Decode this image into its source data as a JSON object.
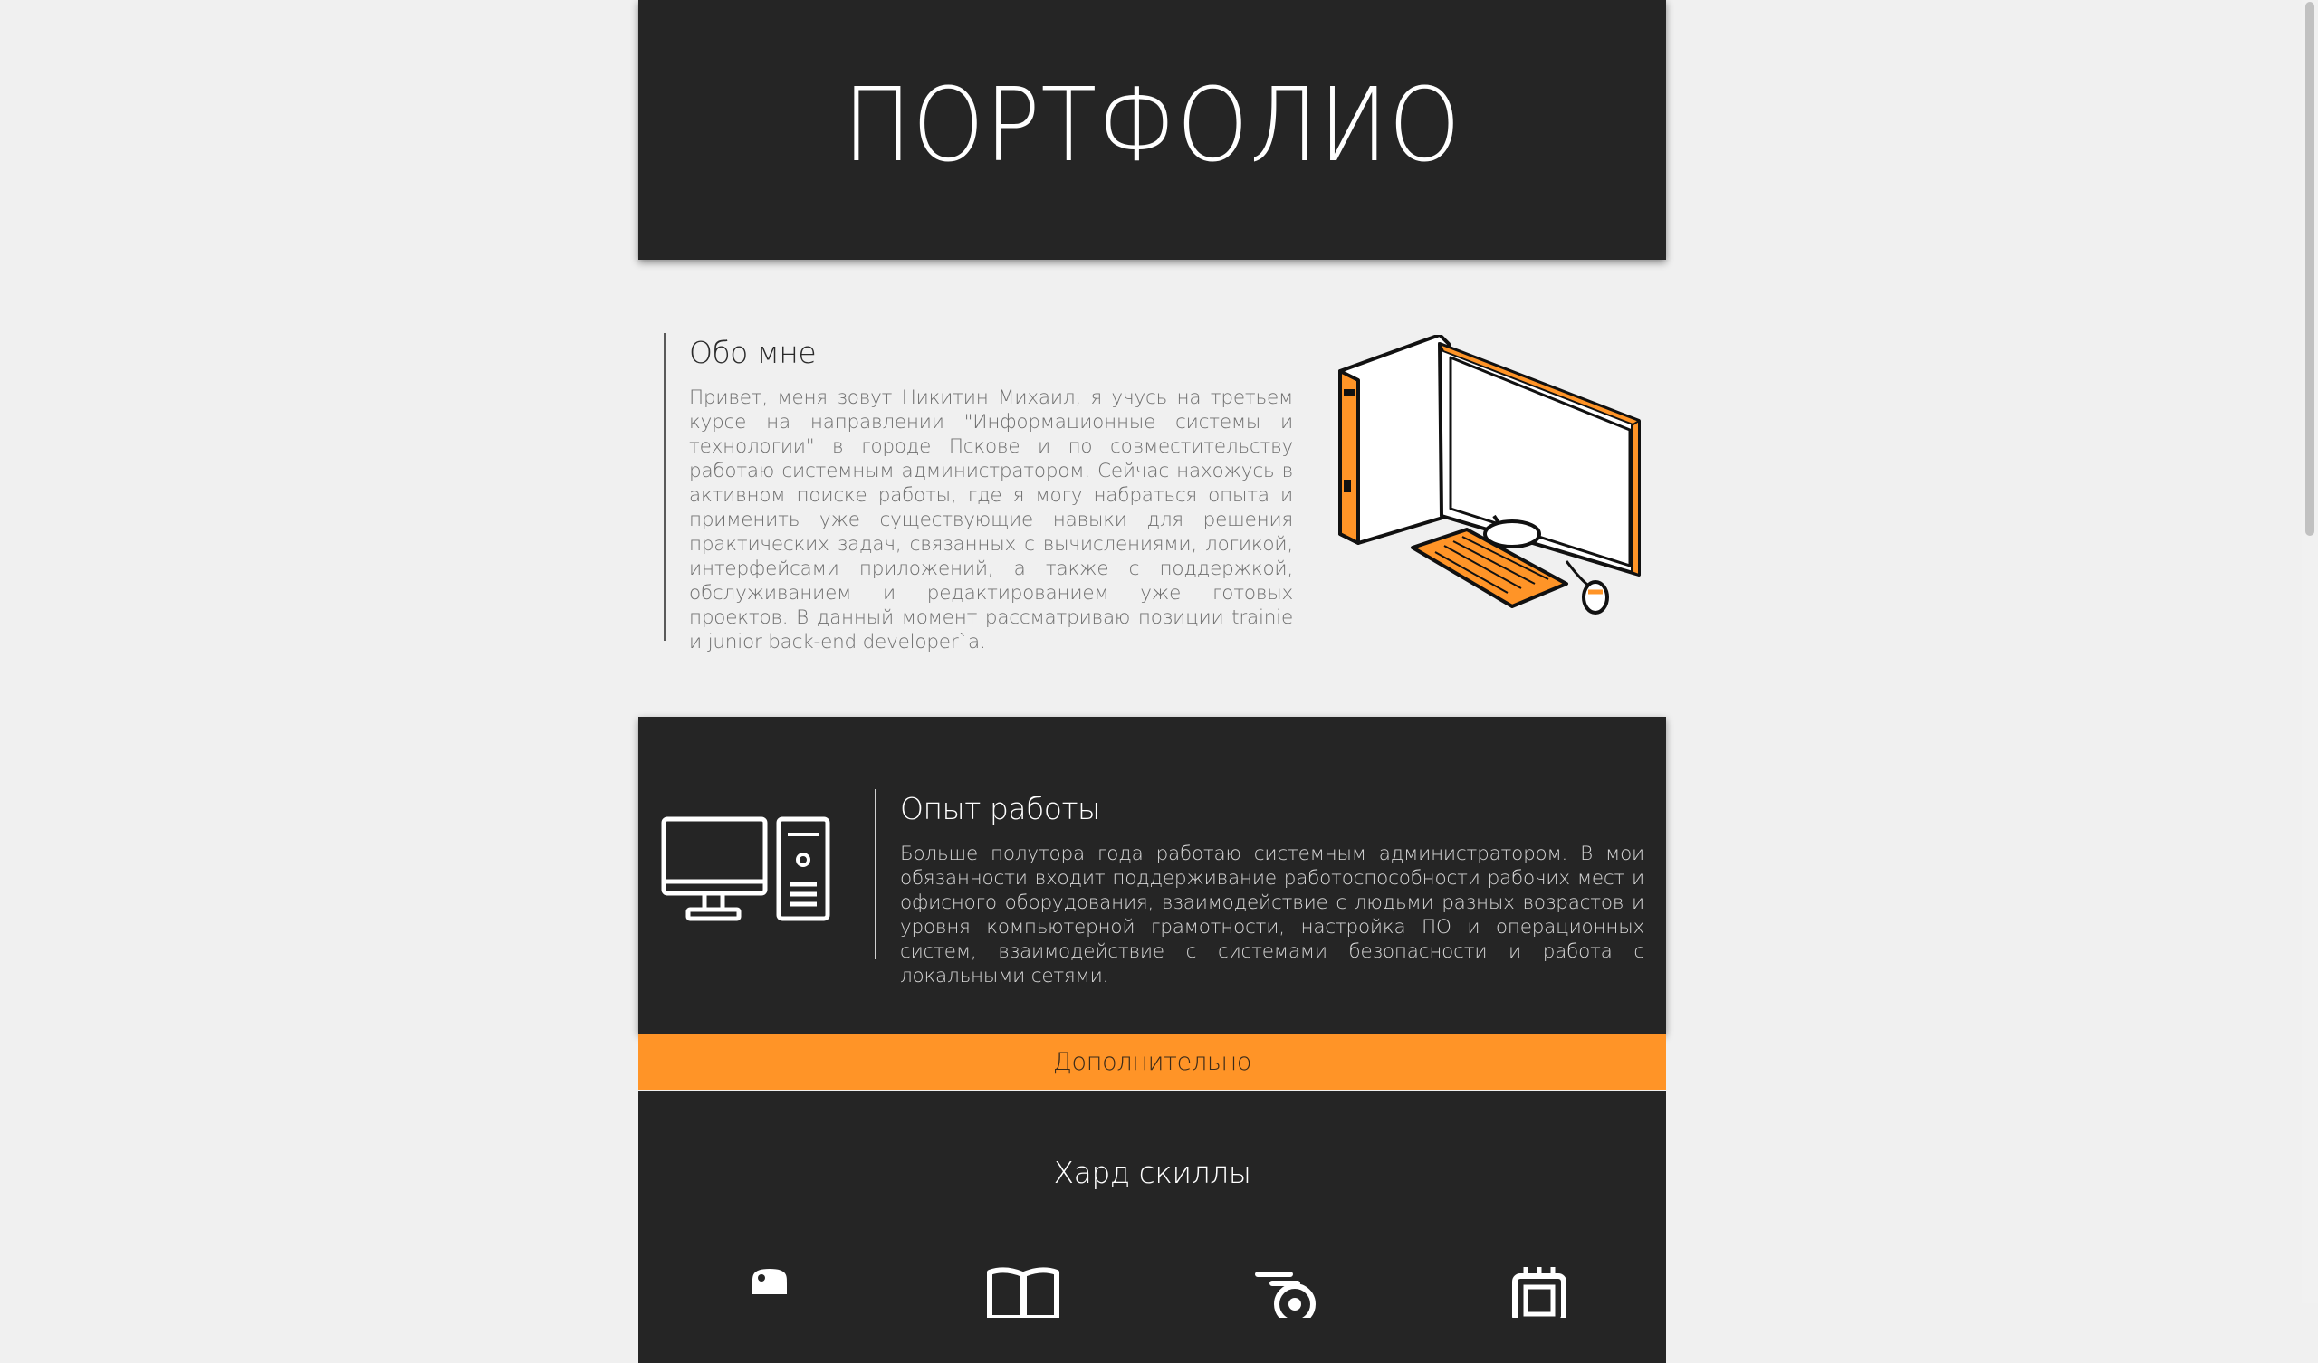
{
  "hero": {
    "title": "ПОРТФОЛИО"
  },
  "about": {
    "heading": "Обо мне",
    "text": "Привет, меня зовут Никитин Михаил, я учусь на третьем курсе на направлении \"Информационные системы и технологии\" в городе Пскове и по совместительству работаю системным администратором. Сейчас нахожусь в активном поиске работы, где я могу набраться опыта и применить уже существующие навыки для решения практических задач, связанных с вычислениями, логикой, интерфейсами приложений, а также с поддержкой, обслуживанием и редактированием уже готовых проектов. В данный момент рассматриваю позиции trainie и junior back-end developer`a.",
    "illustration_icon": "computer-illustration"
  },
  "experience": {
    "heading": "Опыт работы",
    "text": "Больше полутора года работаю системным администратором. В мои обязанности входит поддерживание работоспособности рабочих мест и офисного оборудования, взаимодействие с людьми разных возрастов и уровня компьютерной грамотности, настройка ПО и операционных систем, взаимодействие с системами безопасности и работа с локальными сетями.",
    "icon": "desktop-computer-icon"
  },
  "more_button": {
    "label": "Дополнительно"
  },
  "skills": {
    "heading": "Хард скиллы",
    "icons": [
      "python-icon",
      "book-icon",
      "blender-icon",
      "chip-icon"
    ]
  },
  "colors": {
    "dark_panel": "#252525",
    "accent": "#ff9427",
    "background": "#f0f0f0"
  }
}
